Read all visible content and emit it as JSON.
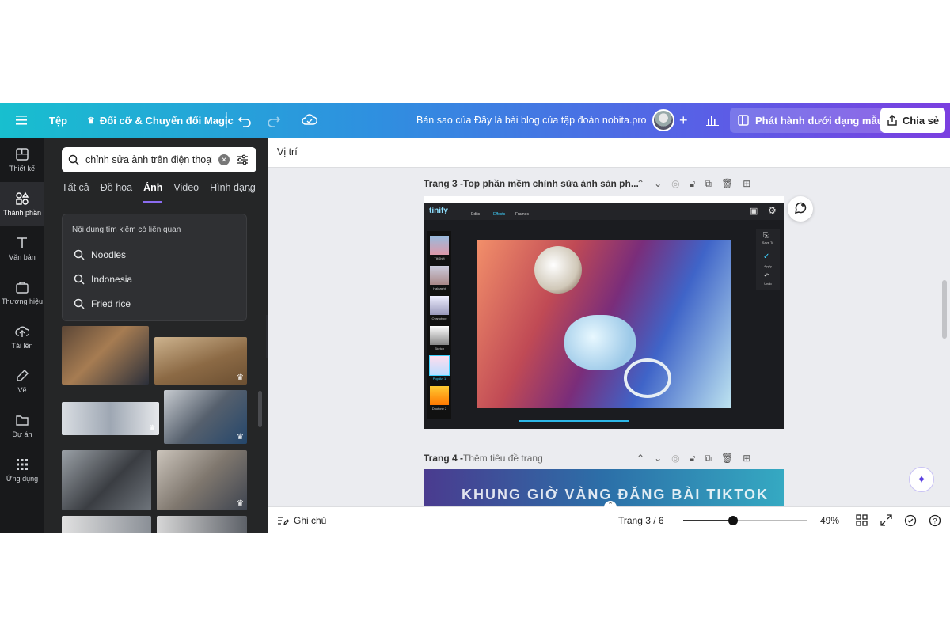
{
  "topbar": {
    "file_label": "Tệp",
    "magic_label": "Đổi cỡ & Chuyển đổi Magic",
    "doc_title": "Bản sao của Đây là bài blog của tập đoàn nobita.pro",
    "publish_label": "Phát hành dưới dạng mẫu",
    "share_label": "Chia sẻ"
  },
  "rail": {
    "items": [
      {
        "label": "Thiết kế",
        "icon": "layout-icon"
      },
      {
        "label": "Thành phần",
        "icon": "elements-icon"
      },
      {
        "label": "Văn bản",
        "icon": "text-icon"
      },
      {
        "label": "Thương hiệu",
        "icon": "brand-icon"
      },
      {
        "label": "Tải lên",
        "icon": "upload-icon"
      },
      {
        "label": "Vẽ",
        "icon": "draw-icon"
      },
      {
        "label": "Dự án",
        "icon": "folder-icon"
      },
      {
        "label": "Ứng dụng",
        "icon": "apps-icon"
      }
    ]
  },
  "panel": {
    "search_value": "chỉnh sửa ảnh trên điện thoại",
    "tabs": [
      "Tất cả",
      "Đồ họa",
      "Ảnh",
      "Video",
      "Hình dạng"
    ],
    "active_tab": "Ảnh",
    "suggest_title": "Nội dung tìm kiếm có liên quan",
    "suggestions": [
      "Noodles",
      "Indonesia",
      "Fried rice"
    ]
  },
  "canvas": {
    "position_label": "Vị trí",
    "page3_prefix": "Trang 3 - ",
    "page3_title": "Top phần mềm chỉnh sửa ảnh sản ph...",
    "page4_prefix": "Trang 4 - ",
    "page4_title": "Thêm tiêu đề trang",
    "page4_banner": "KHUNG GIỜ VÀNG ĐĂNG BÀI TIKTOK",
    "editor": {
      "logo": "tinify",
      "top_tabs": [
        "Edits",
        "Effects",
        "Frames"
      ],
      "filters": [
        "TiltShift",
        "Halgasht",
        "Cyanotype",
        "Sketch",
        "Pop Art 1",
        "Duotone 2"
      ],
      "side_actions": [
        "Save To",
        "Apply",
        "Undo"
      ]
    }
  },
  "bottombar": {
    "notes_label": "Ghi chú",
    "page_indicator": "Trang 3 / 6",
    "zoom_value": 0.49,
    "zoom_label": "49%"
  },
  "colors": {
    "brand_gradient_start": "#18bfcf",
    "brand_gradient_end": "#7b3fe0",
    "panel_bg": "#252627",
    "rail_bg": "#18191b",
    "accent": "#8b6cf0"
  }
}
